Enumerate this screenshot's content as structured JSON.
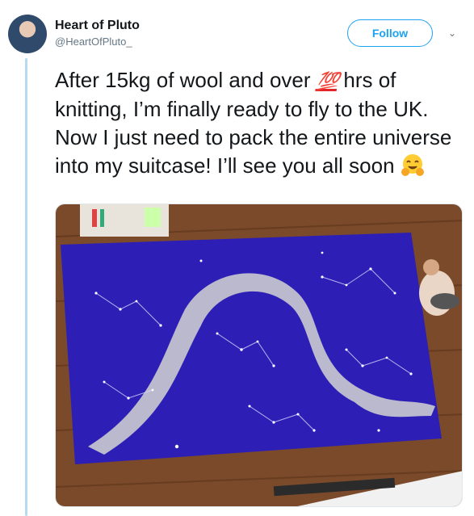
{
  "author": {
    "display_name": "Heart of Pluto",
    "handle": "@HeartOfPluto_",
    "avatar_icon": "profile-photo"
  },
  "actions": {
    "follow_label": "Follow",
    "menu_icon": "chevron-down-icon"
  },
  "tweet": {
    "text_part1": "After 15kg of wool and over ",
    "emoji_100": "💯",
    "text_part2": " hrs of knitting, I’m finally ready to fly to the UK. Now I just need to pack the entire universe into my suitcase! I’ll see you all soon ",
    "emoji_hug_icon": "hugging-face-emoji"
  },
  "media": {
    "description_icon": "knitted-star-map-blanket-photo"
  },
  "colors": {
    "link_blue": "#1da1f2",
    "thread_line": "#b5dbf3",
    "blanket_blue": "#2d1fb6",
    "milky_way": "#c7c7cf"
  }
}
